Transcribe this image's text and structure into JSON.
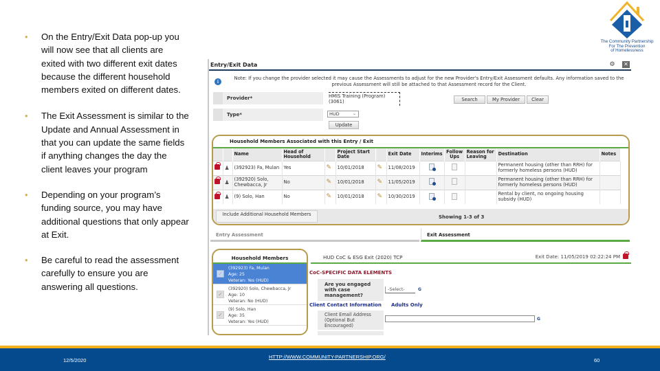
{
  "bullets": [
    "On the Entry/Exit Data pop-up you will now see that all clients are exited with two different exit dates because the different household members exited on different dates.",
    "The Exit Assessment is similar to the Update and Annual Assessment in that you can update the same fields if anything changes the day the client leaves your program",
    "Depending on your program’s funding source, you may have additional questions that only appear at Exit.",
    "Be careful to read the assessment carefully to ensure you are answering all questions."
  ],
  "bullet_glyph": "•",
  "logo": {
    "text_line1": "The Community Partnership",
    "text_line2": "For The Prevention",
    "text_line3": "of Homelessness",
    "colors": {
      "blue": "#1b5ea8",
      "gold": "#f0b429"
    }
  },
  "popup": {
    "title": "Entry/Exit Data",
    "icons": {
      "tool": "⚙",
      "close": "✕"
    },
    "note": "Note: If you change the provider selected it may cause the Assessments to adjust for the new Provider's Entry/Exit Assessment defaults. Any information saved to the previous Assessment will still be attached to that Assessment record for the Client.",
    "provider_label": "Provider*",
    "provider_value": "HMIS Training (Program) (3061)",
    "type_label": "Type*",
    "type_value": "HUD",
    "buttons": {
      "search": "Search",
      "my_provider": "My Provider",
      "clear": "Clear",
      "update": "Update"
    }
  },
  "household": {
    "title": "Household Members Associated with this Entry / Exit",
    "columns": [
      "Name",
      "Head of Household",
      "Project Start Date",
      "Exit Date",
      "Interims",
      "Follow Ups",
      "Reason for Leaving",
      "Destination",
      "Notes"
    ],
    "rows": [
      {
        "name": "(392923) Fa, Mulan",
        "head": "Yes",
        "start": "10/01/2018",
        "exit": "11/08/2019",
        "reason": "",
        "destination": "Permanent housing (other than RRH) for formerly homeless persons (HUD)",
        "notes": ""
      },
      {
        "name": "(392920) Solo, Chewbacca, Jr",
        "head": "No",
        "start": "10/01/2018",
        "exit": "11/05/2019",
        "reason": "",
        "destination": "Permanent housing (other than RRH) for formerly homeless persons (HUD)",
        "notes": ""
      },
      {
        "name": "(9) Solo, Han",
        "head": "No",
        "start": "10/01/2018",
        "exit": "10/30/2019",
        "reason": "",
        "destination": "Rental by client, no ongoing housing subsidy (HUD)",
        "notes": ""
      }
    ],
    "include_button": "Include Additional Household Members",
    "showing": "Showing 1-3 of 3"
  },
  "tabs": {
    "entry": "Entry Assessment",
    "exit": "Exit Assessment"
  },
  "members_panel": {
    "title": "Household Members",
    "items": [
      {
        "line1": "(392923) Fa, Mulan",
        "line2": "Age: 25",
        "line3": "Veteran: Yes (HUD)",
        "selected": true
      },
      {
        "line1": "(392920) Solo, Chewbacca, Jr",
        "line2": "Age: 10",
        "line3": "Veteran: No (HUD)",
        "selected": false
      },
      {
        "line1": "(9) Solo, Han",
        "line2": "Age: 35",
        "line3": "Veteran: Yes (HUD)",
        "selected": false
      }
    ]
  },
  "assessment": {
    "name": "HUD CoC & ESG Exit (2020) TCP",
    "exit_date": "Exit Date: 11/05/2019 02:22:24 PM",
    "section_title": "CoC-SPECIFIC DATA ELEMENTS",
    "question_case_mgmt": "Are you engaged with case management?",
    "select_value": "-Select-",
    "g_mark": "G",
    "contact_section": "Client Contact Information",
    "adults_only": "Adults Only",
    "email_label": "Client Email Address (Optional But Encouraged)",
    "email_value": ""
  },
  "footer": {
    "date": "12/5/2020",
    "link": "HTTP://WWW.COMMUNITY-PARTNERSHIP.ORG/",
    "page": "60",
    "colors": {
      "bar": "#044a8c",
      "accent": "#f3b21b"
    }
  }
}
